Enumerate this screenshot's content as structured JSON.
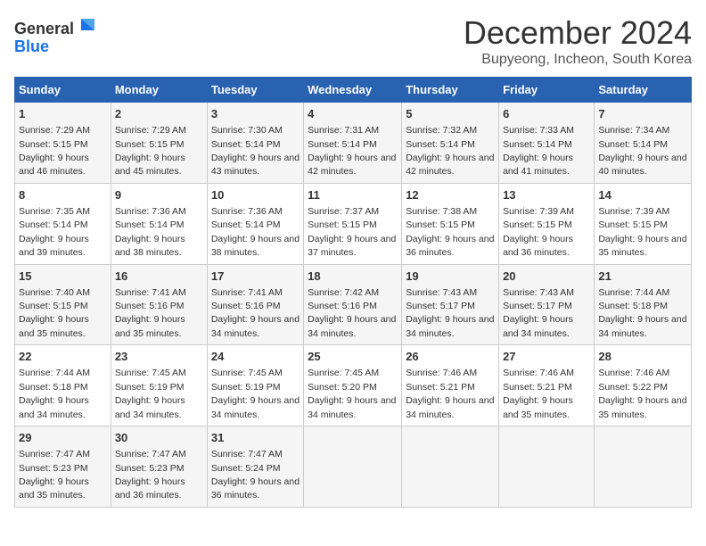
{
  "logo": {
    "general": "General",
    "blue": "Blue"
  },
  "title": {
    "month": "December 2024",
    "location": "Bupyeong, Incheon, South Korea"
  },
  "weekdays": [
    "Sunday",
    "Monday",
    "Tuesday",
    "Wednesday",
    "Thursday",
    "Friday",
    "Saturday"
  ],
  "weeks": [
    [
      {
        "day": "1",
        "sunrise": "Sunrise: 7:29 AM",
        "sunset": "Sunset: 5:15 PM",
        "daylight": "Daylight: 9 hours and 46 minutes."
      },
      {
        "day": "2",
        "sunrise": "Sunrise: 7:29 AM",
        "sunset": "Sunset: 5:15 PM",
        "daylight": "Daylight: 9 hours and 45 minutes."
      },
      {
        "day": "3",
        "sunrise": "Sunrise: 7:30 AM",
        "sunset": "Sunset: 5:14 PM",
        "daylight": "Daylight: 9 hours and 43 minutes."
      },
      {
        "day": "4",
        "sunrise": "Sunrise: 7:31 AM",
        "sunset": "Sunset: 5:14 PM",
        "daylight": "Daylight: 9 hours and 42 minutes."
      },
      {
        "day": "5",
        "sunrise": "Sunrise: 7:32 AM",
        "sunset": "Sunset: 5:14 PM",
        "daylight": "Daylight: 9 hours and 42 minutes."
      },
      {
        "day": "6",
        "sunrise": "Sunrise: 7:33 AM",
        "sunset": "Sunset: 5:14 PM",
        "daylight": "Daylight: 9 hours and 41 minutes."
      },
      {
        "day": "7",
        "sunrise": "Sunrise: 7:34 AM",
        "sunset": "Sunset: 5:14 PM",
        "daylight": "Daylight: 9 hours and 40 minutes."
      }
    ],
    [
      {
        "day": "8",
        "sunrise": "Sunrise: 7:35 AM",
        "sunset": "Sunset: 5:14 PM",
        "daylight": "Daylight: 9 hours and 39 minutes."
      },
      {
        "day": "9",
        "sunrise": "Sunrise: 7:36 AM",
        "sunset": "Sunset: 5:14 PM",
        "daylight": "Daylight: 9 hours and 38 minutes."
      },
      {
        "day": "10",
        "sunrise": "Sunrise: 7:36 AM",
        "sunset": "Sunset: 5:14 PM",
        "daylight": "Daylight: 9 hours and 38 minutes."
      },
      {
        "day": "11",
        "sunrise": "Sunrise: 7:37 AM",
        "sunset": "Sunset: 5:15 PM",
        "daylight": "Daylight: 9 hours and 37 minutes."
      },
      {
        "day": "12",
        "sunrise": "Sunrise: 7:38 AM",
        "sunset": "Sunset: 5:15 PM",
        "daylight": "Daylight: 9 hours and 36 minutes."
      },
      {
        "day": "13",
        "sunrise": "Sunrise: 7:39 AM",
        "sunset": "Sunset: 5:15 PM",
        "daylight": "Daylight: 9 hours and 36 minutes."
      },
      {
        "day": "14",
        "sunrise": "Sunrise: 7:39 AM",
        "sunset": "Sunset: 5:15 PM",
        "daylight": "Daylight: 9 hours and 35 minutes."
      }
    ],
    [
      {
        "day": "15",
        "sunrise": "Sunrise: 7:40 AM",
        "sunset": "Sunset: 5:15 PM",
        "daylight": "Daylight: 9 hours and 35 minutes."
      },
      {
        "day": "16",
        "sunrise": "Sunrise: 7:41 AM",
        "sunset": "Sunset: 5:16 PM",
        "daylight": "Daylight: 9 hours and 35 minutes."
      },
      {
        "day": "17",
        "sunrise": "Sunrise: 7:41 AM",
        "sunset": "Sunset: 5:16 PM",
        "daylight": "Daylight: 9 hours and 34 minutes."
      },
      {
        "day": "18",
        "sunrise": "Sunrise: 7:42 AM",
        "sunset": "Sunset: 5:16 PM",
        "daylight": "Daylight: 9 hours and 34 minutes."
      },
      {
        "day": "19",
        "sunrise": "Sunrise: 7:43 AM",
        "sunset": "Sunset: 5:17 PM",
        "daylight": "Daylight: 9 hours and 34 minutes."
      },
      {
        "day": "20",
        "sunrise": "Sunrise: 7:43 AM",
        "sunset": "Sunset: 5:17 PM",
        "daylight": "Daylight: 9 hours and 34 minutes."
      },
      {
        "day": "21",
        "sunrise": "Sunrise: 7:44 AM",
        "sunset": "Sunset: 5:18 PM",
        "daylight": "Daylight: 9 hours and 34 minutes."
      }
    ],
    [
      {
        "day": "22",
        "sunrise": "Sunrise: 7:44 AM",
        "sunset": "Sunset: 5:18 PM",
        "daylight": "Daylight: 9 hours and 34 minutes."
      },
      {
        "day": "23",
        "sunrise": "Sunrise: 7:45 AM",
        "sunset": "Sunset: 5:19 PM",
        "daylight": "Daylight: 9 hours and 34 minutes."
      },
      {
        "day": "24",
        "sunrise": "Sunrise: 7:45 AM",
        "sunset": "Sunset: 5:19 PM",
        "daylight": "Daylight: 9 hours and 34 minutes."
      },
      {
        "day": "25",
        "sunrise": "Sunrise: 7:45 AM",
        "sunset": "Sunset: 5:20 PM",
        "daylight": "Daylight: 9 hours and 34 minutes."
      },
      {
        "day": "26",
        "sunrise": "Sunrise: 7:46 AM",
        "sunset": "Sunset: 5:21 PM",
        "daylight": "Daylight: 9 hours and 34 minutes."
      },
      {
        "day": "27",
        "sunrise": "Sunrise: 7:46 AM",
        "sunset": "Sunset: 5:21 PM",
        "daylight": "Daylight: 9 hours and 35 minutes."
      },
      {
        "day": "28",
        "sunrise": "Sunrise: 7:46 AM",
        "sunset": "Sunset: 5:22 PM",
        "daylight": "Daylight: 9 hours and 35 minutes."
      }
    ],
    [
      {
        "day": "29",
        "sunrise": "Sunrise: 7:47 AM",
        "sunset": "Sunset: 5:23 PM",
        "daylight": "Daylight: 9 hours and 35 minutes."
      },
      {
        "day": "30",
        "sunrise": "Sunrise: 7:47 AM",
        "sunset": "Sunset: 5:23 PM",
        "daylight": "Daylight: 9 hours and 36 minutes."
      },
      {
        "day": "31",
        "sunrise": "Sunrise: 7:47 AM",
        "sunset": "Sunset: 5:24 PM",
        "daylight": "Daylight: 9 hours and 36 minutes."
      },
      null,
      null,
      null,
      null
    ]
  ]
}
